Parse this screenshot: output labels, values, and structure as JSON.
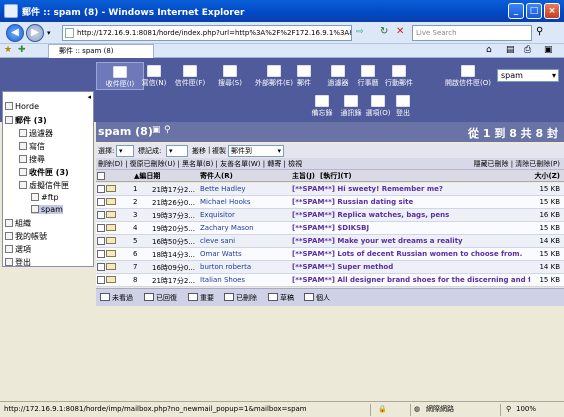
{
  "window": {
    "title": "郵件 :: spam (8) - Windows Internet Explorer"
  },
  "browser": {
    "url": "http://172.16.9.1:8081/horde/index.php?url=http%3A%2F%2F172.16.9.1%3A8081%2Fhorde%2F",
    "search_placeholder": "Live Search",
    "tab_label": "郵件 :: spam (8)"
  },
  "nav": {
    "row1": [
      "收件匣(I)",
      "寫信(N)",
      "信件匣(F)",
      "搜尋(S)",
      "外部郵件(E)",
      "郵件",
      "過濾器",
      "行事曆",
      "行動郵件"
    ],
    "open_folder_label": "開啟信件匣(O)",
    "mailbox_select": "spam",
    "row2": [
      "備忘錄",
      "通訊錄",
      "選項(O)",
      "登出"
    ]
  },
  "sidebar": {
    "items": [
      {
        "label": "Horde",
        "level": 0
      },
      {
        "label": "郵件 (3)",
        "level": 0
      },
      {
        "label": "過濾器",
        "level": 1
      },
      {
        "label": "寫信",
        "level": 1
      },
      {
        "label": "搜尋",
        "level": 1
      },
      {
        "label": "收件匣 (3)",
        "level": 1
      },
      {
        "label": "虛擬信件匣",
        "level": 1
      },
      {
        "label": "#ftp",
        "level": 2
      },
      {
        "label": "spam",
        "level": 2
      },
      {
        "label": "組織",
        "level": 0
      },
      {
        "label": "我的帳號",
        "level": 0
      },
      {
        "label": "選項",
        "level": 0
      },
      {
        "label": "登出",
        "level": 0
      }
    ]
  },
  "main": {
    "folder_title": "spam (8)",
    "range": "從 1 到 8 共 8 封",
    "select_label": "選擇:",
    "mark_label": "標記成:",
    "move_label": "搬移",
    "copy_label": "複製",
    "move_to": "郵件到",
    "actions_left": "刪除(D) | 復原已刪除(U) | 黑名單(B) | 友善名單(W) | 轉寄 | 檢視",
    "actions_right": "隱藏已刪除 | 清除已刪除(P)",
    "columns": [
      "編日期",
      "寄件人(R)",
      "主旨(J)",
      "[執行](T)",
      "大小(Z)"
    ],
    "rows": [
      {
        "n": "1",
        "date": "21時17分2...",
        "from": "Bette Hadley",
        "subject": "[**SPAM**] Hi sweety! Remember me?",
        "size": "15 KB"
      },
      {
        "n": "2",
        "date": "21時26分0...",
        "from": "Michael Hooks",
        "subject": "[**SPAM**] Russian dating site",
        "size": "15 KB"
      },
      {
        "n": "3",
        "date": "19時37分3...",
        "from": "Exquisitor",
        "subject": "[**SPAM**] Replica watches, bags, pens",
        "size": "16 KB"
      },
      {
        "n": "4",
        "date": "19時20分5...",
        "from": "Zachary Mason",
        "subject": "[**SPAM**] $DIKSBJ",
        "size": "15 KB"
      },
      {
        "n": "5",
        "date": "16時50分5...",
        "from": "cleve sani",
        "subject": "[**SPAM**] Make your wet dreams a reality",
        "size": "14 KB"
      },
      {
        "n": "6",
        "date": "18時14分3...",
        "from": "Omar Watts",
        "subject": "[**SPAM**] Lots of decent Russian women to choose from.",
        "size": "15 KB"
      },
      {
        "n": "7",
        "date": "16時09分0...",
        "from": "burton roberta",
        "subject": "[**SPAM**] Super method",
        "size": "14 KB"
      },
      {
        "n": "8",
        "date": "21時17分2...",
        "from": "Italian Shoes",
        "subject": "[**SPAM**] All designer brand shoes for the discerning and fashion...",
        "size": "15 KB"
      }
    ],
    "legend": [
      "未看過",
      "已回復",
      "重要",
      "已刪除",
      "草稿",
      "個人"
    ]
  },
  "status": {
    "url": "http://172.16.9.1:8081/horde/imp/mailbox.php?no_newmail_popup=1&mailbox=spam",
    "zone": "網際網路",
    "zoom": "100%"
  }
}
